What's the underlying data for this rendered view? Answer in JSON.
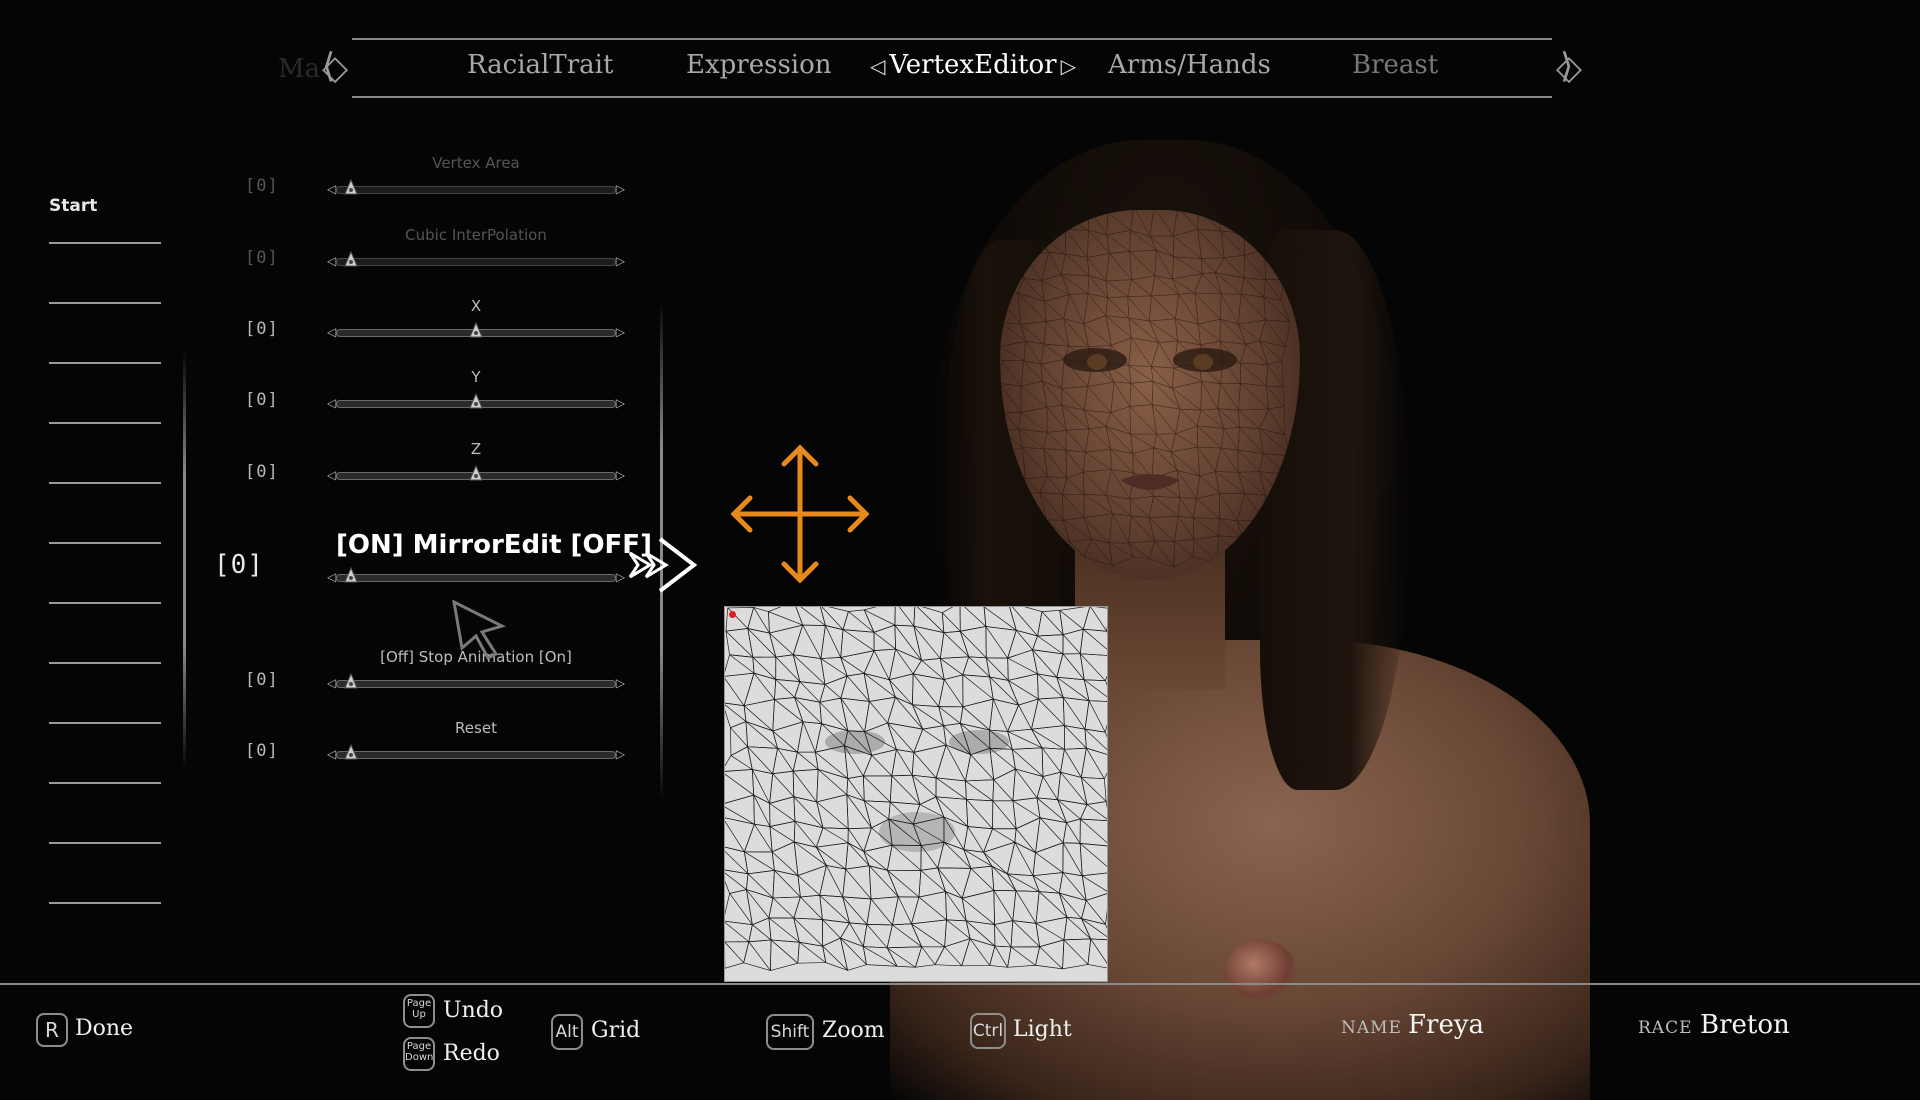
{
  "tabs": {
    "ghost": "Ma",
    "items": [
      {
        "label": "RacialTrait",
        "state": "normal"
      },
      {
        "label": "Expression",
        "state": "normal"
      },
      {
        "label": "VertexEditor",
        "state": "active"
      },
      {
        "label": "Arms/Hands",
        "state": "normal"
      },
      {
        "label": "Breast",
        "state": "dim"
      }
    ]
  },
  "left_column": {
    "start_label": "Start",
    "line_count": 12
  },
  "sliders": [
    {
      "label": "Vertex Area",
      "value": "[0]",
      "level": 0.05,
      "state": "dim"
    },
    {
      "label": "Cubic InterPolation",
      "value": "[0]",
      "level": 0.05,
      "state": "dim"
    },
    {
      "label": "X",
      "value": "[0]",
      "level": 0.5,
      "state": "normal"
    },
    {
      "label": "Y",
      "value": "[0]",
      "level": 0.5,
      "state": "normal"
    },
    {
      "label": "Z",
      "value": "[0]",
      "level": 0.5,
      "state": "normal"
    },
    {
      "label": "[ON] MirrorEdit [OFF]",
      "value": "[0]",
      "level": 0.05,
      "state": "active"
    },
    {
      "label": "[Off] Stop Animation [On]",
      "value": "[0]",
      "level": 0.05,
      "state": "normal"
    },
    {
      "label": "Reset",
      "value": "[0]",
      "level": 0.05,
      "state": "normal"
    }
  ],
  "bottom": {
    "done": {
      "key": "R",
      "label": "Done"
    },
    "undo": {
      "key": "Page Up",
      "label": "Undo"
    },
    "redo": {
      "key": "Page Down",
      "label": "Redo"
    },
    "grid": {
      "key": "Alt",
      "label": "Grid"
    },
    "zoom": {
      "key": "Shift",
      "label": "Zoom"
    },
    "light": {
      "key": "Ctrl",
      "label": "Light"
    },
    "name_label": "NAME",
    "name_value": "Freya",
    "race_label": "RACE",
    "race_value": "Breton"
  },
  "colors": {
    "gizmo": "#e8891c",
    "uv_background": "#dcdcdc",
    "uv_marker": "#e02020"
  }
}
